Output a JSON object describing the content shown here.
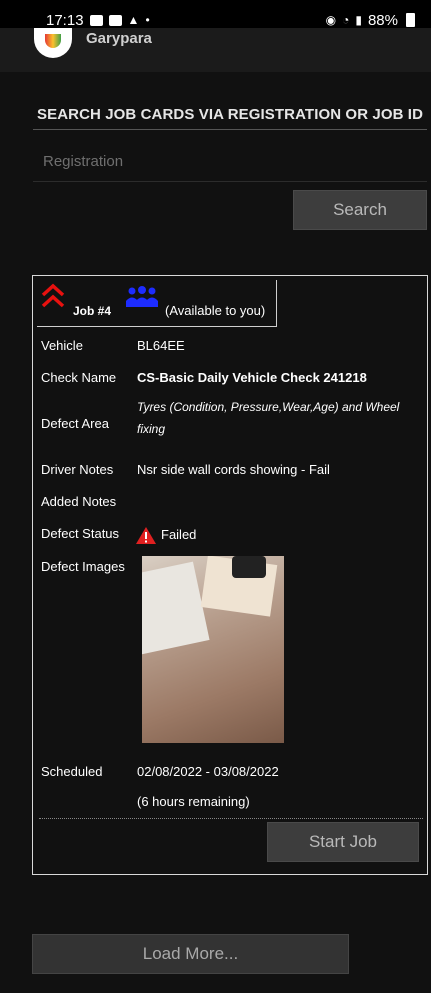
{
  "status_bar": {
    "time": "17:13",
    "battery": "88%",
    "icons": [
      "notification-icon",
      "notification-icon",
      "bell-icon",
      "dot-icon",
      "alarm-icon",
      "wifi-icon",
      "signal-icon",
      "battery-icon"
    ]
  },
  "app": {
    "name": "Garypara"
  },
  "search": {
    "title": "SEARCH JOB CARDS VIA REGISTRATION OR JOB ID",
    "input_placeholder": "Registration",
    "input_value": "",
    "button_label": "Search"
  },
  "job": {
    "label": "Job #4",
    "availability": "(Available to you)",
    "rows": [
      {
        "label": "Vehicle",
        "value": "BL64EE"
      },
      {
        "label": "Check Name",
        "value": "CS-Basic Daily Vehicle Check 241218"
      },
      {
        "label": "Defect Area",
        "value": "Tyres (Condition, Pressure,Wear,Age) and Wheel fixing"
      },
      {
        "label": "Driver Notes",
        "value": "Nsr side wall cords showing - Fail"
      },
      {
        "label": "Added Notes",
        "value": ""
      },
      {
        "label": "Defect Status",
        "value": "Failed"
      },
      {
        "label": "Defect Images",
        "value": ""
      },
      {
        "label": "Scheduled",
        "value": "02/08/2022 - 03/08/2022"
      }
    ],
    "remaining": "(6 hours remaining)",
    "start_label": "Start Job",
    "colors": {
      "priority": "#e8110f",
      "people": "#1d2cff",
      "warning": "#e02020"
    }
  },
  "load_more_label": "Load More..."
}
